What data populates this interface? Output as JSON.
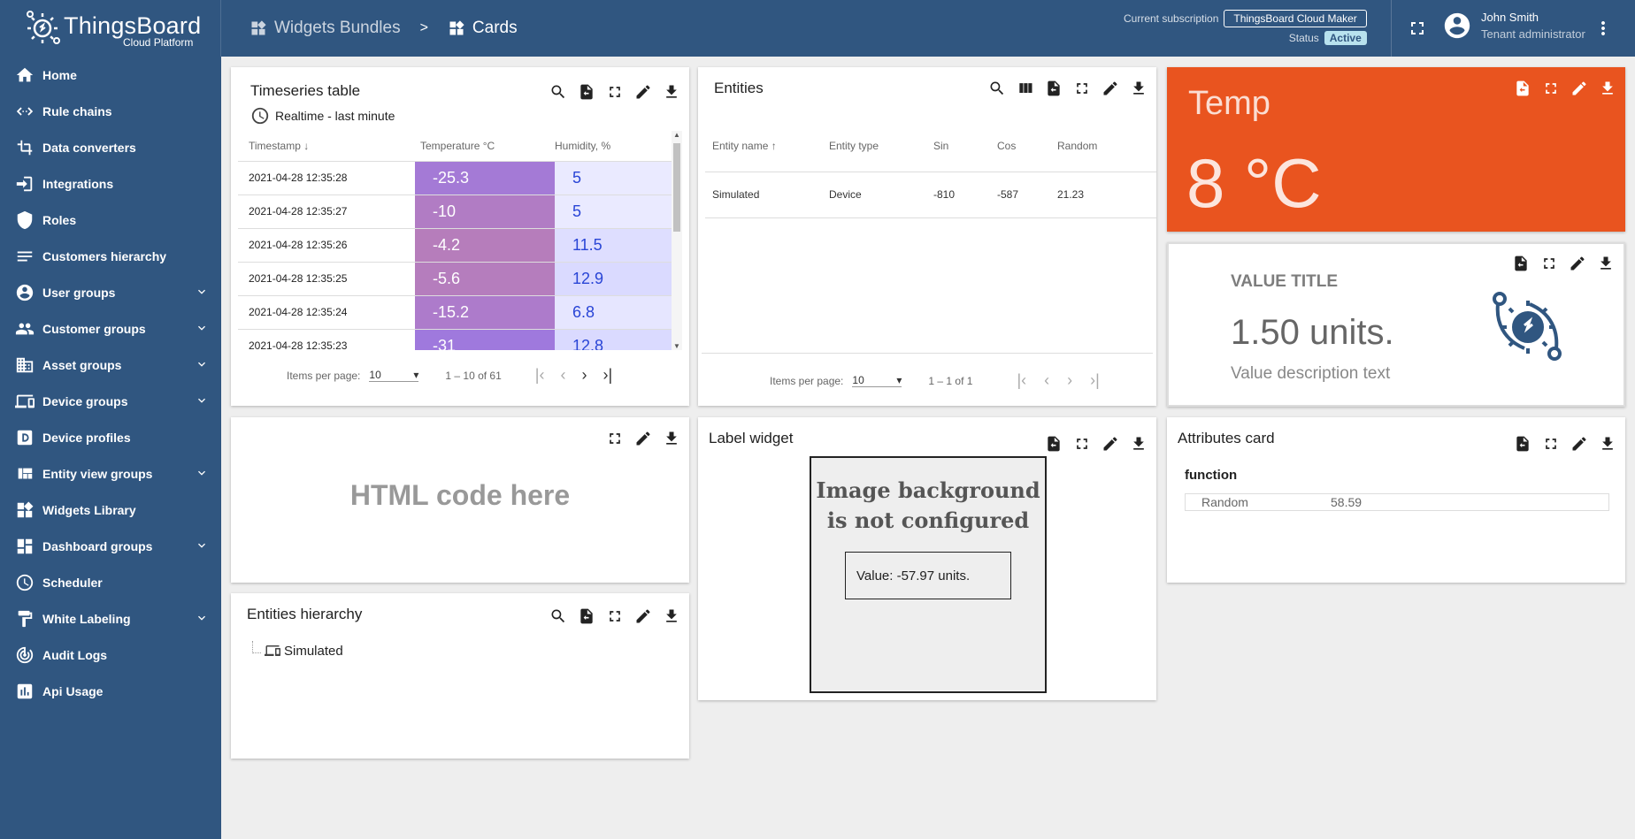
{
  "brand": {
    "name": "ThingsBoard",
    "sub": "Cloud Platform"
  },
  "breadcrumb": {
    "bundles": "Widgets Bundles",
    "sep": ">",
    "current": "Cards"
  },
  "subscription": {
    "label": "Current subscription",
    "plan": "ThingsBoard Cloud Maker",
    "status_label": "Status",
    "status": "Active"
  },
  "user": {
    "name": "John Smith",
    "role": "Tenant administrator"
  },
  "colors": {
    "primary": "#305680",
    "temp_card": "#f25819",
    "status_bg": "#b8e2ee"
  },
  "sidebar": {
    "items": [
      {
        "label": "Home",
        "icon": "home-icon",
        "expandable": false
      },
      {
        "label": "Rule chains",
        "icon": "rule-chains-icon",
        "expandable": false
      },
      {
        "label": "Data converters",
        "icon": "data-converters-icon",
        "expandable": false
      },
      {
        "label": "Integrations",
        "icon": "integrations-icon",
        "expandable": false
      },
      {
        "label": "Roles",
        "icon": "shield-icon",
        "expandable": false
      },
      {
        "label": "Customers hierarchy",
        "icon": "hierarchy-icon",
        "expandable": false
      },
      {
        "label": "User groups",
        "icon": "account-circle-icon",
        "expandable": true
      },
      {
        "label": "Customer groups",
        "icon": "people-icon",
        "expandable": true
      },
      {
        "label": "Asset groups",
        "icon": "domain-icon",
        "expandable": true
      },
      {
        "label": "Device groups",
        "icon": "devices-icon",
        "expandable": true
      },
      {
        "label": "Device profiles",
        "icon": "device-profile-icon",
        "expandable": false
      },
      {
        "label": "Entity view groups",
        "icon": "view-quilt-icon",
        "expandable": true
      },
      {
        "label": "Widgets Library",
        "icon": "widgets-icon",
        "expandable": false
      },
      {
        "label": "Dashboard groups",
        "icon": "dashboard-icon",
        "expandable": true
      },
      {
        "label": "Scheduler",
        "icon": "clock-icon",
        "expandable": false
      },
      {
        "label": "White Labeling",
        "icon": "paint-roller-icon",
        "expandable": true
      },
      {
        "label": "Audit Logs",
        "icon": "track-changes-icon",
        "expandable": false
      },
      {
        "label": "Api Usage",
        "icon": "insert-chart-icon",
        "expandable": false
      }
    ]
  },
  "timeseries": {
    "title": "Timeseries table",
    "timewindow": "Realtime - last minute",
    "columns": [
      "Timestamp",
      "Temperature °C",
      "Humidity, %"
    ],
    "rows": [
      {
        "ts": "2021-04-28 12:35:28",
        "temp": "-25.3",
        "hum": "5",
        "temp_color": "#a47ad6",
        "hum_color": "#eaeaff"
      },
      {
        "ts": "2021-04-28 12:35:27",
        "temp": "-10",
        "hum": "5",
        "temp_color": "#b17cc4",
        "hum_color": "#eaeaff"
      },
      {
        "ts": "2021-04-28 12:35:26",
        "temp": "-4.2",
        "hum": "11.5",
        "temp_color": "#b67dbb",
        "hum_color": "#dedeff"
      },
      {
        "ts": "2021-04-28 12:35:25",
        "temp": "-5.6",
        "hum": "12.9",
        "temp_color": "#b57dbd",
        "hum_color": "#dadaff"
      },
      {
        "ts": "2021-04-28 12:35:24",
        "temp": "-15.2",
        "hum": "6.8",
        "temp_color": "#ad7bcb",
        "hum_color": "#e6e6ff"
      },
      {
        "ts": "2021-04-28 12:35:23",
        "temp": "-31",
        "hum": "12.8",
        "temp_color": "#9f79dd",
        "hum_color": "#dadaff"
      }
    ],
    "paginator": {
      "items_label": "Items per page:",
      "page_size": "10",
      "range": "1 – 10 of 61"
    }
  },
  "entities": {
    "title": "Entities",
    "columns": [
      "Entity name",
      "Entity type",
      "Sin",
      "Cos",
      "Random"
    ],
    "rows": [
      {
        "name": "Simulated",
        "type": "Device",
        "sin": "-810",
        "cos": "-587",
        "random": "21.23"
      }
    ],
    "paginator": {
      "items_label": "Items per page:",
      "page_size": "10",
      "range": "1 – 1 of 1"
    }
  },
  "temp": {
    "title": "Temp",
    "value": "8 °C"
  },
  "value_card": {
    "title": "VALUE TITLE",
    "value": "1.50 units.",
    "description": "Value description text"
  },
  "html_card": {
    "text": "HTML code here"
  },
  "label_widget": {
    "title": "Label widget",
    "bg_line1": "Image background",
    "bg_line2": "is not configured",
    "value": "Value: -57.97 units."
  },
  "attributes_card": {
    "title": "Attributes card",
    "group": "function",
    "key": "Random",
    "value": "58.59"
  },
  "hierarchy": {
    "title": "Entities hierarchy",
    "node": "Simulated"
  }
}
